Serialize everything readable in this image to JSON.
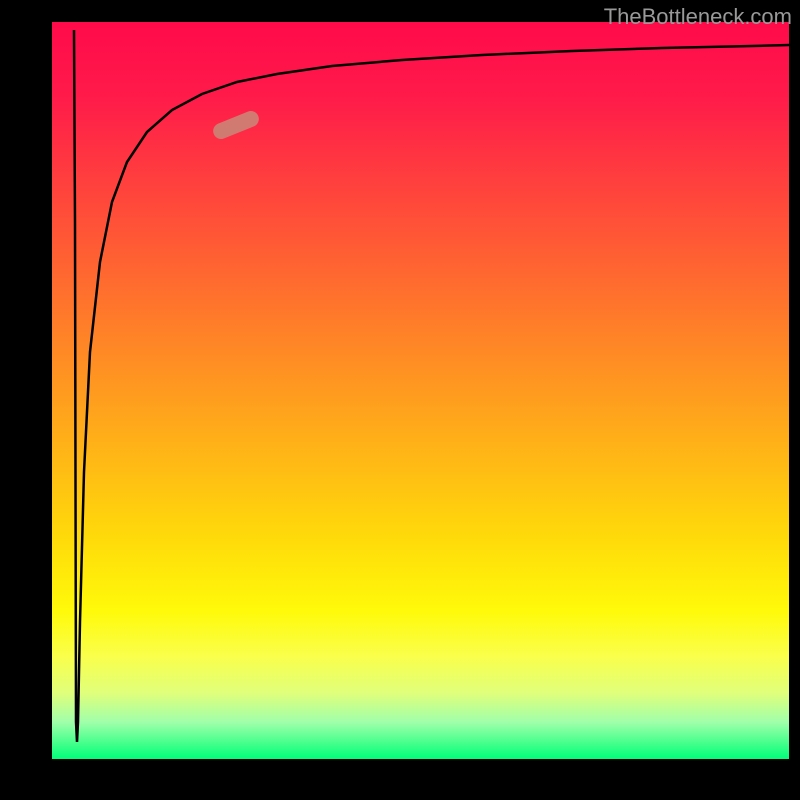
{
  "watermark_text": "TheBottleneck.com",
  "chart_data": {
    "type": "line",
    "title": "",
    "xlabel": "",
    "ylabel": "",
    "xlim": [
      0,
      100
    ],
    "ylim": [
      0,
      100
    ],
    "grid": false,
    "background_gradient": {
      "direction": "vertical",
      "stops": [
        {
          "pos": 0,
          "color": "#ff0a4a"
        },
        {
          "pos": 50,
          "color": "#ffaa1a"
        },
        {
          "pos": 80,
          "color": "#fffa0a"
        },
        {
          "pos": 100,
          "color": "#00ff7a"
        }
      ]
    },
    "series": [
      {
        "name": "bottleneck-curve",
        "color": "#000000",
        "x": [
          3,
          3.2,
          3.5,
          4,
          5,
          6,
          8,
          10,
          12,
          15,
          18,
          22,
          26,
          30,
          40,
          50,
          60,
          70,
          80,
          90,
          100
        ],
        "y": [
          99,
          50,
          10,
          30,
          55,
          65,
          75,
          80,
          83,
          86,
          88,
          89.5,
          90.5,
          91.2,
          92.5,
          93.3,
          93.8,
          94.2,
          94.5,
          94.7,
          94.9
        ]
      }
    ],
    "annotations": [
      {
        "type": "marker",
        "name": "highlight-segment",
        "x_range": [
          21,
          26
        ],
        "y_range": [
          84,
          87
        ],
        "color": "#c88a7a"
      }
    ]
  }
}
